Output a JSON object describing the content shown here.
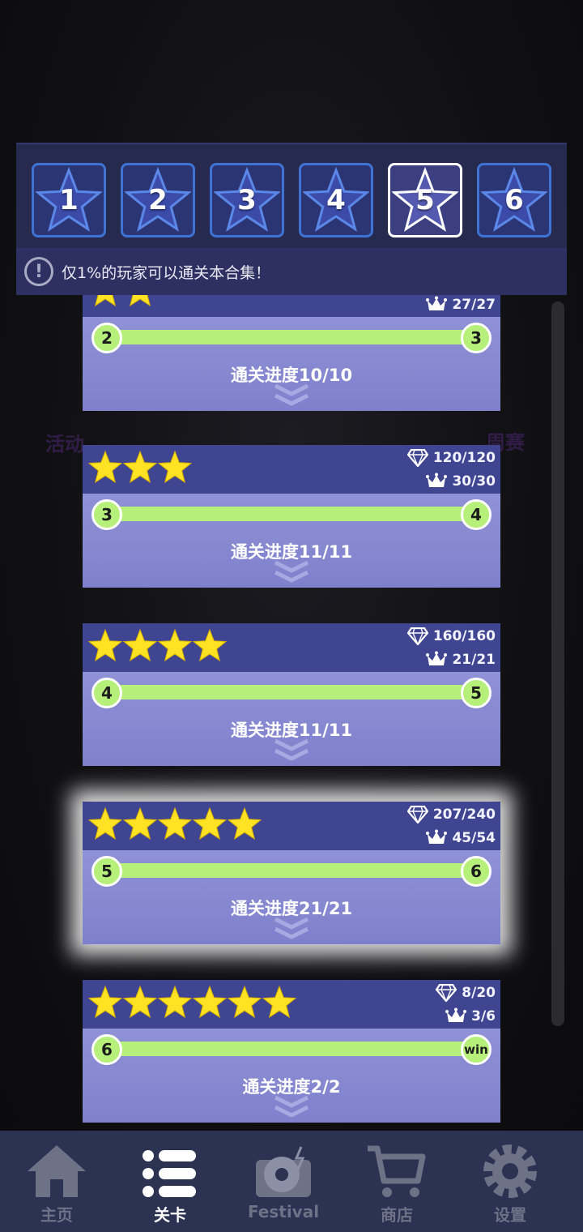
{
  "tabs": [
    {
      "label": "1",
      "active": false
    },
    {
      "label": "2",
      "active": false
    },
    {
      "label": "3",
      "active": false
    },
    {
      "label": "4",
      "active": false
    },
    {
      "label": "5",
      "active": true
    },
    {
      "label": "6",
      "active": false
    }
  ],
  "notice": {
    "icon": "exclamation-icon",
    "text": "仅1%的玩家可以通关本合集！"
  },
  "background_labels": {
    "left": "活动",
    "right": "周赛"
  },
  "cards": [
    {
      "stars": 2,
      "gems": "",
      "crowns": "27/27",
      "from": "2",
      "to": "3",
      "progress": "通关进度10/10",
      "highlight": false
    },
    {
      "stars": 3,
      "gems": "120/120",
      "crowns": "30/30",
      "from": "3",
      "to": "4",
      "progress": "通关进度11/11",
      "highlight": false
    },
    {
      "stars": 4,
      "gems": "160/160",
      "crowns": "21/21",
      "from": "4",
      "to": "5",
      "progress": "通关进度11/11",
      "highlight": false
    },
    {
      "stars": 5,
      "gems": "207/240",
      "crowns": "45/54",
      "from": "5",
      "to": "6",
      "progress": "通关进度21/21",
      "highlight": true
    },
    {
      "stars": 6,
      "gems": "8/20",
      "crowns": "3/6",
      "from": "6",
      "to": "win",
      "progress": "通关进度2/2",
      "highlight": false
    }
  ],
  "nav": [
    {
      "label": "主页",
      "icon": "home-icon",
      "active": false
    },
    {
      "label": "关卡",
      "icon": "list-icon",
      "active": true
    },
    {
      "label": "Festival",
      "icon": "record-player-icon",
      "active": false
    },
    {
      "label": "商店",
      "icon": "cart-icon",
      "active": false
    },
    {
      "label": "设置",
      "icon": "gear-icon",
      "active": false
    }
  ],
  "colors": {
    "accent_green": "#b6f07a",
    "card_header": "#3f4591",
    "star": "#ffe223",
    "tab_border": "#3f73d3"
  }
}
